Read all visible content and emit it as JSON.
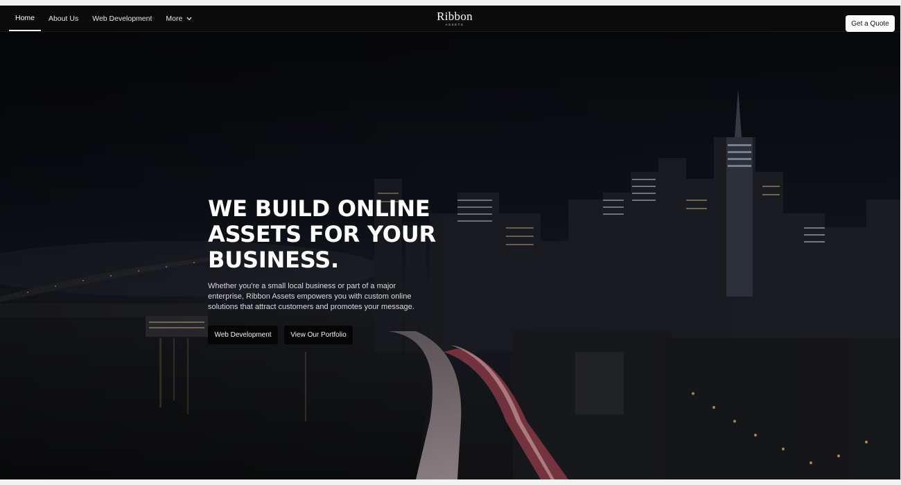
{
  "nav": {
    "items": [
      {
        "label": "Home",
        "active": true
      },
      {
        "label": "About Us"
      },
      {
        "label": "Web Development"
      },
      {
        "label": "More",
        "icon": "chevron-down-icon"
      }
    ],
    "logo_main": "Ribbon",
    "logo_sub": "ASSETS",
    "cta_label": "Get a Quote"
  },
  "hero": {
    "title": "WE BUILD ONLINE ASSETS FOR YOUR BUSINESS.",
    "description": "Whether you're a small local business or part of a major enterprise, Ribbon Assets empowers you with custom online solutions that attract customers and promotes your message.",
    "primary_button": "Web Development",
    "secondary_button": "View Our Portfolio",
    "background_image": "night city skyline with river and light-trail highway"
  },
  "colors": {
    "nav_bg": "#0b0b0b",
    "cta_bg": "#ffffff",
    "button_bg": "#050505",
    "text": "#ffffff"
  }
}
